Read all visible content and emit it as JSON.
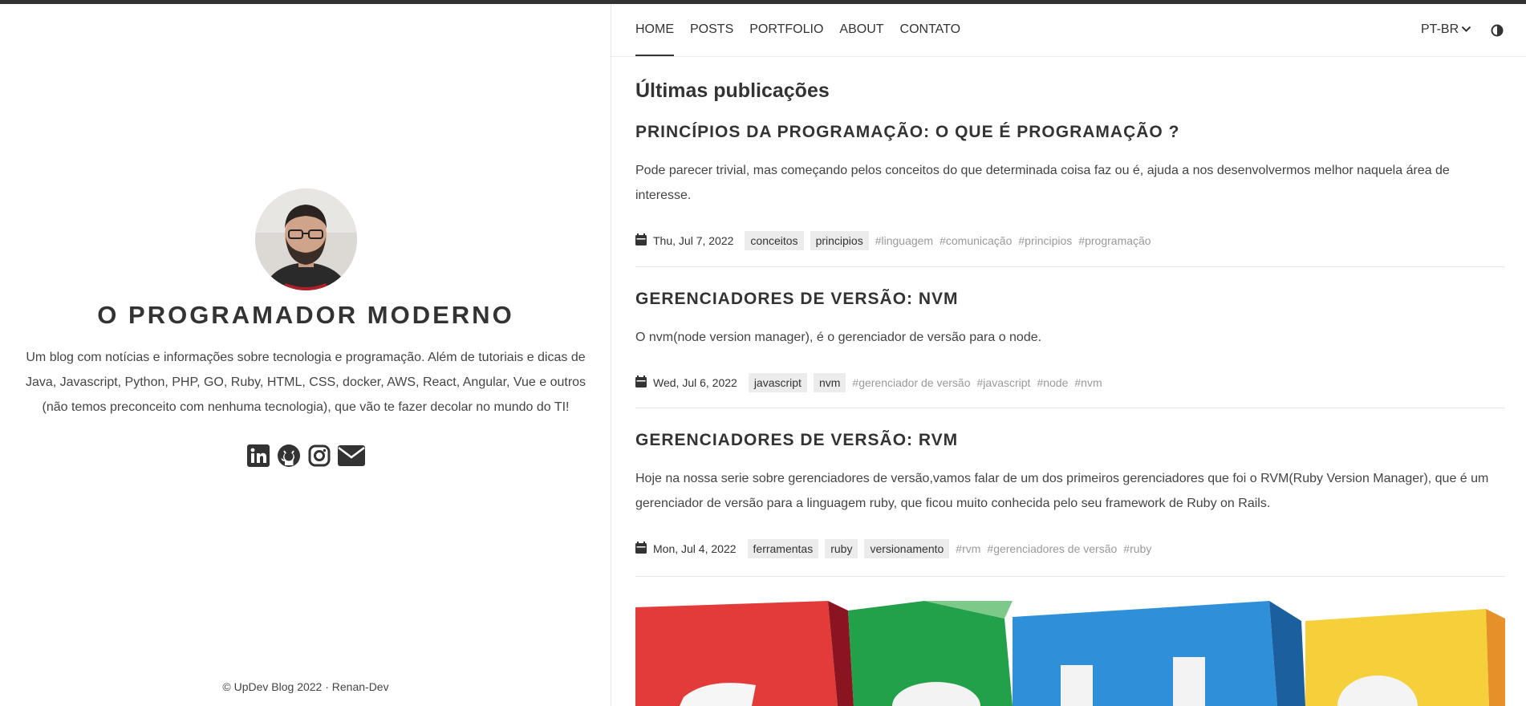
{
  "sidebar": {
    "site_title": "O PROGRAMADOR MODERNO",
    "description": "Um blog com notícias e informações sobre tecnologia e programação. Além de tutoriais e dicas de Java, Javascript, Python, PHP, GO, Ruby, HTML, CSS, docker, AWS, React, Angular, Vue e outros (não temos preconceito com nenhuma tecnologia), que vão te fazer decolar no mundo do TI!",
    "social_icons": [
      "linkedin-icon",
      "github-icon",
      "instagram-icon",
      "email-icon"
    ],
    "footer": "© UpDev Blog 2022 · Renan-Dev"
  },
  "nav": {
    "items": [
      {
        "label": "HOME",
        "active": true
      },
      {
        "label": "POSTS",
        "active": false
      },
      {
        "label": "PORTFOLIO",
        "active": false
      },
      {
        "label": "ABOUT",
        "active": false
      },
      {
        "label": "CONTATO",
        "active": false
      }
    ],
    "language": "PT-BR",
    "theme_icon": "contrast-icon"
  },
  "main": {
    "section_title": "Últimas publicações",
    "posts": [
      {
        "title": "PRINCÍPIOS DA PROGRAMAÇÃO: O QUE É PROGRAMAÇÃO ?",
        "summary": "Pode parecer trivial, mas começando pelos conceitos do que determinada coisa faz ou é, ajuda a nos desenvolvermos melhor naquela área de interesse.",
        "date": "Thu, Jul 7, 2022",
        "categories": [
          "conceitos",
          "principios"
        ],
        "tags": [
          "#linguagem",
          "#comunicação",
          "#principios",
          "#programação"
        ]
      },
      {
        "title": "GERENCIADORES DE VERSÃO: NVM",
        "summary": "O nvm(node version manager), é o gerenciador de versão para o node.",
        "date": "Wed, Jul 6, 2022",
        "categories": [
          "javascript",
          "nvm"
        ],
        "tags": [
          "#gerenciador de versão",
          "#javascript",
          "#node",
          "#nvm"
        ]
      },
      {
        "title": "GERENCIADORES DE VERSÃO: RVM",
        "summary": "Hoje na nossa serie sobre gerenciadores de versão,vamos falar de um dos primeiros gerenciadores que foi o RVM(Ruby Version Manager), que é um gerenciador de versão para a linguagem ruby, que ficou muito conhecida pelo seu framework de Ruby on Rails.",
        "date": "Mon, Jul 4, 2022",
        "categories": [
          "ferramentas",
          "ruby",
          "versionamento"
        ],
        "tags": [
          "#rvm",
          "#gerenciadores de versão",
          "#ruby"
        ]
      }
    ]
  }
}
